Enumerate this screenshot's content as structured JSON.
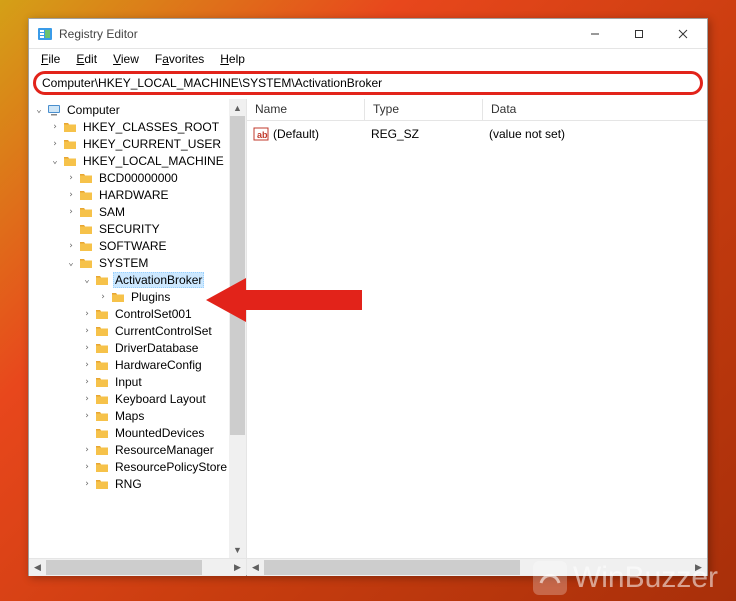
{
  "window": {
    "title": "Registry Editor",
    "minimize": "–",
    "maximize": "☐",
    "close": "✕"
  },
  "menu": {
    "file": "File",
    "edit": "Edit",
    "view": "View",
    "favorites": "Favorites",
    "help": "Help"
  },
  "address": {
    "value": "Computer\\HKEY_LOCAL_MACHINE\\SYSTEM\\ActivationBroker"
  },
  "tree": {
    "root": "Computer",
    "hkcr": "HKEY_CLASSES_ROOT",
    "hkcu": "HKEY_CURRENT_USER",
    "hklm": "HKEY_LOCAL_MACHINE",
    "bcd": "BCD00000000",
    "hardware": "HARDWARE",
    "sam": "SAM",
    "security": "SECURITY",
    "software": "SOFTWARE",
    "system": "SYSTEM",
    "activationbroker": "ActivationBroker",
    "plugins": "Plugins",
    "controlset001": "ControlSet001",
    "currentcontrolset": "CurrentControlSet",
    "driverdatabase": "DriverDatabase",
    "hardwareconfig": "HardwareConfig",
    "input": "Input",
    "keyboardlayout": "Keyboard Layout",
    "maps": "Maps",
    "mounteddevices": "MountedDevices",
    "resourcemanager": "ResourceManager",
    "resourcepolicystore": "ResourcePolicyStore",
    "rng": "RNG"
  },
  "columns": {
    "name": "Name",
    "type": "Type",
    "data": "Data"
  },
  "values": [
    {
      "name": "(Default)",
      "type": "REG_SZ",
      "data": "(value not set)"
    }
  ],
  "watermark": "WinBuzzer"
}
